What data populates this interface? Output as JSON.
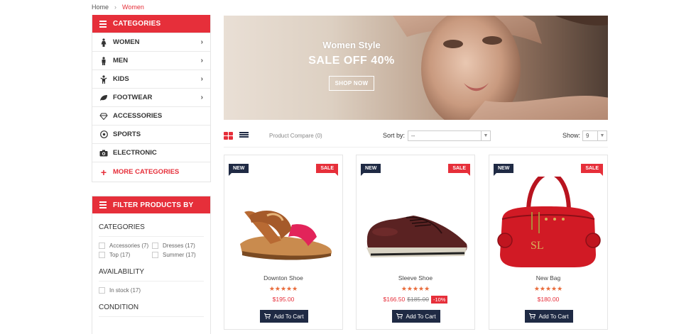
{
  "breadcrumb": {
    "home": "Home",
    "separator": "›",
    "current": "Women"
  },
  "categories": {
    "title": "CATEGORIES",
    "items": [
      {
        "label": "WOMEN",
        "icon": "female-icon",
        "has_submenu": true
      },
      {
        "label": "MEN",
        "icon": "male-icon",
        "has_submenu": true
      },
      {
        "label": "KIDS",
        "icon": "child-icon",
        "has_submenu": true
      },
      {
        "label": "FOOTWEAR",
        "icon": "leaf-icon",
        "has_submenu": true
      },
      {
        "label": "ACCESSORIES",
        "icon": "diamond-icon",
        "has_submenu": false
      },
      {
        "label": "SPORTS",
        "icon": "soccer-ball-icon",
        "has_submenu": false
      },
      {
        "label": "ELECTRONIC",
        "icon": "camera-icon",
        "has_submenu": false
      }
    ],
    "more_label": "MORE CATEGORIES"
  },
  "filter": {
    "title": "FILTER PRODUCTS BY",
    "categories_title": "CATEGORIES",
    "category_options": [
      "Accessories (7)",
      "Dresses (17)",
      "Top (17)",
      "Summer (17)"
    ],
    "availability_title": "AVAILABILITY",
    "availability_options": [
      "In stock (17)"
    ],
    "condition_title": "CONDITION"
  },
  "banner": {
    "line1": "Women Style",
    "line2": "SALE OFF 40%",
    "button": "SHOP NOW"
  },
  "toolbar": {
    "compare": "Product Compare (0)",
    "sort_label": "Sort by:",
    "sort_value": "--",
    "show_label": "Show:",
    "show_value": "9"
  },
  "products": [
    {
      "new_tag": "NEW",
      "sale_tag": "SALE",
      "name": "Downton Shoe",
      "stars": "★★★★★",
      "price": "$195.00",
      "old_price": "",
      "discount": "",
      "cart": "Add To Cart"
    },
    {
      "new_tag": "NEW",
      "sale_tag": "SALE",
      "name": "Sleeve Shoe",
      "stars": "★★★★★",
      "price": "$166.50",
      "old_price": "$185.00",
      "discount": "-10%",
      "cart": "Add To Cart"
    },
    {
      "new_tag": "NEW",
      "sale_tag": "SALE",
      "name": "New Bag",
      "stars": "★★★★★",
      "price": "$180.00",
      "old_price": "",
      "discount": "",
      "cart": "Add To Cart"
    }
  ],
  "colors": {
    "accent": "#e62f3a",
    "dark": "#1f2a44",
    "star": "#e96b3a"
  }
}
